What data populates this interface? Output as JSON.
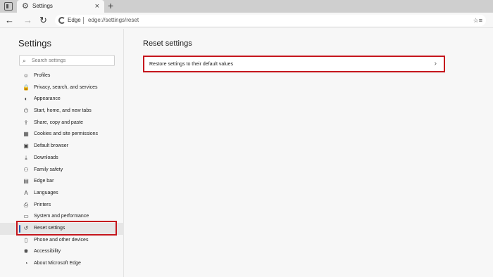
{
  "browser": {
    "tab": {
      "title": "Settings",
      "close": "×"
    },
    "new_tab": "+",
    "address": {
      "site_label": "Edge",
      "url": "edge://settings/reset"
    },
    "nav": {
      "back": "←",
      "forward": "→",
      "refresh": "↻"
    },
    "favorite_icon": "☆≡"
  },
  "sidebar": {
    "title": "Settings",
    "search_placeholder": "Search settings",
    "items": [
      {
        "label": "Profiles",
        "icon": "person-icon",
        "glyph": "☺"
      },
      {
        "label": "Privacy, search, and services",
        "icon": "lock-icon",
        "glyph": "🔒"
      },
      {
        "label": "Appearance",
        "icon": "palette-icon",
        "glyph": "◐"
      },
      {
        "label": "Start, home, and new tabs",
        "icon": "power-icon",
        "glyph": "⏻"
      },
      {
        "label": "Share, copy and paste",
        "icon": "share-icon",
        "glyph": "⇪"
      },
      {
        "label": "Cookies and site permissions",
        "icon": "cookie-icon",
        "glyph": "▦"
      },
      {
        "label": "Default browser",
        "icon": "browser-icon",
        "glyph": "▣"
      },
      {
        "label": "Downloads",
        "icon": "download-icon",
        "glyph": "⤓"
      },
      {
        "label": "Family safety",
        "icon": "family-icon",
        "glyph": "⚇"
      },
      {
        "label": "Edge bar",
        "icon": "edge-bar-icon",
        "glyph": "▤"
      },
      {
        "label": "Languages",
        "icon": "languages-icon",
        "glyph": "A"
      },
      {
        "label": "Printers",
        "icon": "printer-icon",
        "glyph": "⎙"
      },
      {
        "label": "System and performance",
        "icon": "system-icon",
        "glyph": "▭"
      },
      {
        "label": "Reset settings",
        "icon": "reset-icon",
        "glyph": "↺",
        "active": true
      },
      {
        "label": "Phone and other devices",
        "icon": "phone-icon",
        "glyph": "▯"
      },
      {
        "label": "Accessibility",
        "icon": "accessibility-icon",
        "glyph": "✱"
      },
      {
        "label": "About Microsoft Edge",
        "icon": "edge-logo-icon",
        "glyph": "◔"
      }
    ]
  },
  "main": {
    "title": "Reset settings",
    "option": {
      "label": "Restore settings to their default values",
      "chevron": "›"
    }
  },
  "colors": {
    "highlight": "#c5161d",
    "accent": "#1f5fb5"
  }
}
